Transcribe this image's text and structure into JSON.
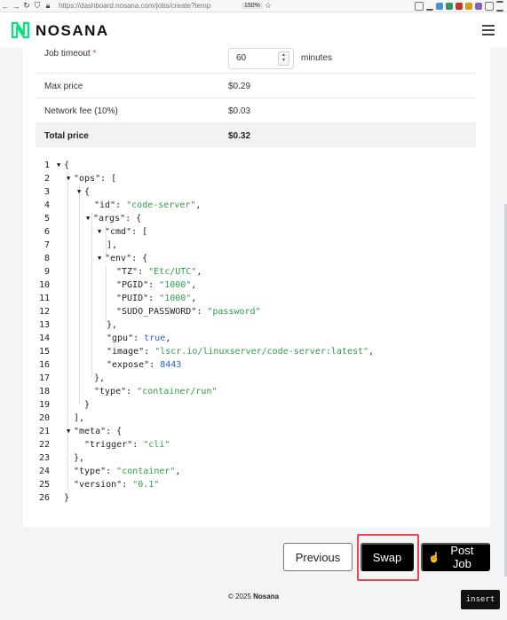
{
  "browser": {
    "url": "https://dashboard.nosana.com/jobs/create?temp",
    "zoom": "150%"
  },
  "app": {
    "brand": "NOSANA",
    "brand_color": "#10e080"
  },
  "form": {
    "timeout_label": "Job timeout",
    "timeout_required": "*",
    "timeout_value": "60",
    "timeout_unit": "minutes",
    "rows": [
      {
        "label": "Max price",
        "value": "$0.29"
      },
      {
        "label": "Network fee (10%)",
        "value": "$0.03"
      },
      {
        "label": "Total price",
        "value": "$0.32"
      }
    ]
  },
  "editor": {
    "lines": [
      {
        "n": "1"
      },
      {
        "n": "2"
      },
      {
        "n": "3"
      },
      {
        "n": "4"
      },
      {
        "n": "5"
      },
      {
        "n": "6"
      },
      {
        "n": "7"
      },
      {
        "n": "8"
      },
      {
        "n": "9"
      },
      {
        "n": "10"
      },
      {
        "n": "11"
      },
      {
        "n": "12"
      },
      {
        "n": "13"
      },
      {
        "n": "14"
      },
      {
        "n": "15"
      },
      {
        "n": "16"
      },
      {
        "n": "17"
      },
      {
        "n": "18"
      },
      {
        "n": "19"
      },
      {
        "n": "20"
      },
      {
        "n": "21"
      },
      {
        "n": "22"
      },
      {
        "n": "23"
      },
      {
        "n": "24"
      },
      {
        "n": "25"
      },
      {
        "n": "26"
      }
    ],
    "tokens": {
      "ops": "\"ops\"",
      "id": "\"id\"",
      "id_val": "\"code-server\"",
      "args": "\"args\"",
      "cmd": "\"cmd\"",
      "env": "\"env\"",
      "tz": "\"TZ\"",
      "tz_val": "\"Etc/UTC\"",
      "pgid": "\"PGID\"",
      "pgid_val": "\"1000\"",
      "puid": "\"PUID\"",
      "puid_val": "\"1000\"",
      "sudo": "\"SUDO_PASSWORD\"",
      "sudo_val": "\"password\"",
      "gpu": "\"gpu\"",
      "gpu_val": "true",
      "image": "\"image\"",
      "image_val": "\"lscr.io/linuxserver/code-server:latest\"",
      "expose": "\"expose\"",
      "expose_val": "8443",
      "type": "\"type\"",
      "type_val": "\"container/run\"",
      "meta": "\"meta\"",
      "trigger": "\"trigger\"",
      "trigger_val": "\"cli\"",
      "type2": "\"type\"",
      "type2_val": "\"container\"",
      "version": "\"version\"",
      "version_val": "\"0.1\""
    }
  },
  "actions": {
    "previous": "Previous",
    "swap": "Swap",
    "post": "Post Job"
  },
  "footer": {
    "copyright": "© 2025",
    "brand": "Nosana"
  },
  "status_badge": "insert"
}
